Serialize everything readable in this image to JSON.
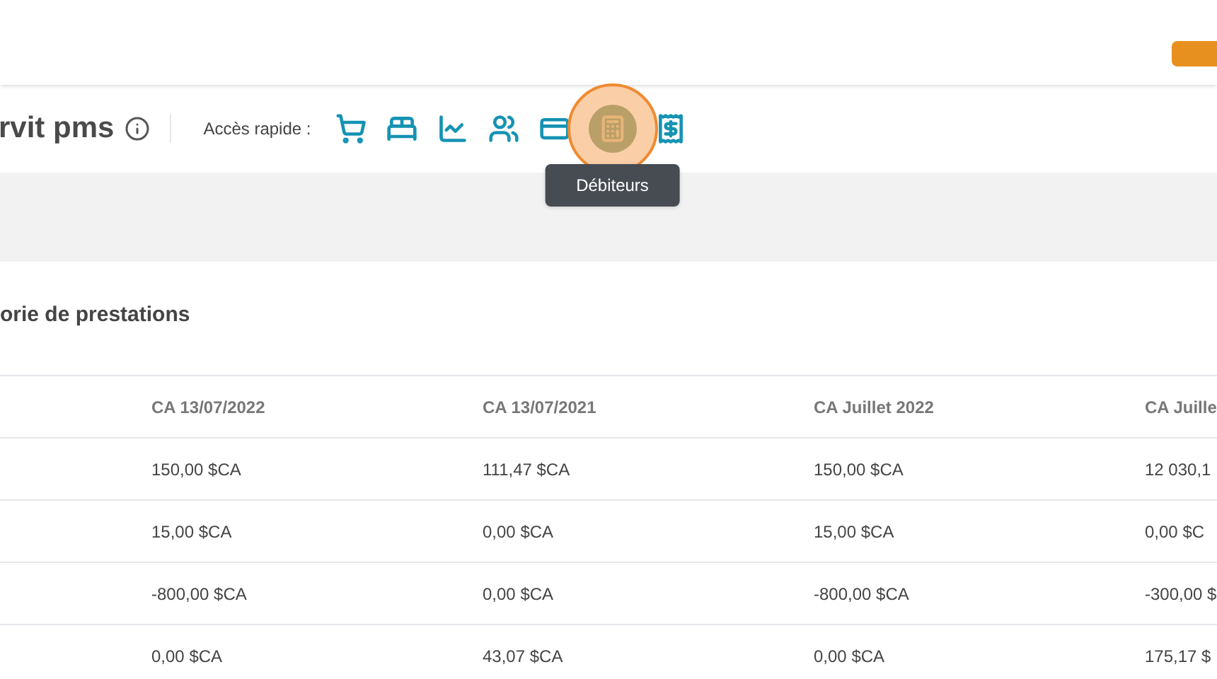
{
  "page_title": "rvit pms",
  "quick_access": {
    "label": "Accès rapide :",
    "items": [
      {
        "kind": "cart",
        "selected": false
      },
      {
        "kind": "bed",
        "selected": false
      },
      {
        "kind": "chart",
        "selected": false
      },
      {
        "kind": "users",
        "selected": false
      },
      {
        "kind": "card",
        "selected": false
      },
      {
        "kind": "register",
        "selected": true
      },
      {
        "kind": "receipt",
        "selected": false
      }
    ],
    "tooltip": "Débiteurs"
  },
  "section_title": "orie de prestations",
  "table": {
    "columns": [
      "CA 13/07/2022",
      "CA 13/07/2021",
      "CA Juillet 2022",
      "CA Juille"
    ],
    "rows": [
      [
        "150,00 $CA",
        "111,47 $CA",
        "150,00 $CA",
        "12 030,1"
      ],
      [
        "15,00 $CA",
        "0,00 $CA",
        "15,00 $CA",
        "0,00 $C"
      ],
      [
        "-800,00 $CA",
        "0,00 $CA",
        "-800,00 $CA",
        "-300,00 $"
      ],
      [
        "0,00 $CA",
        "43,07 $CA",
        "0,00 $CA",
        "175,17 $"
      ]
    ]
  }
}
